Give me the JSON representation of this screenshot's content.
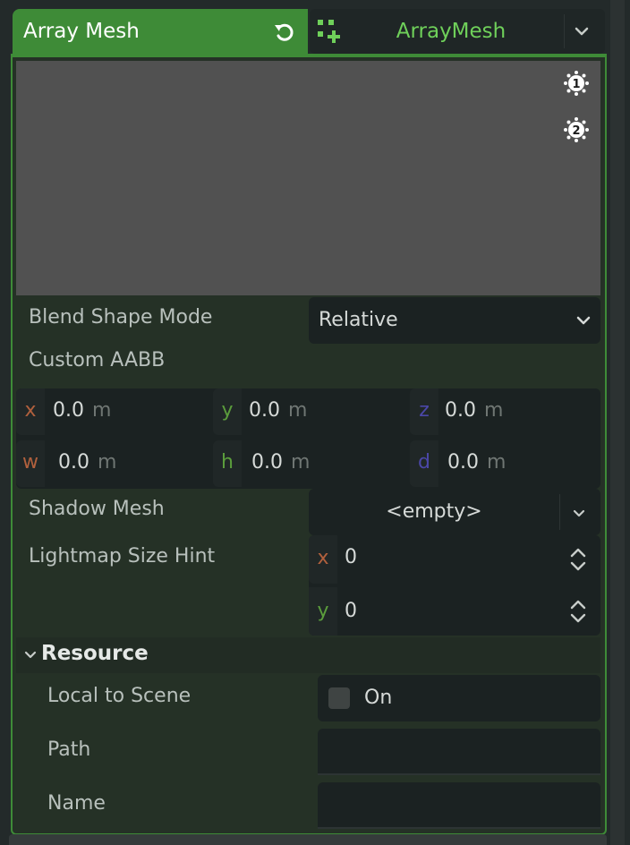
{
  "header": {
    "title": "Array Mesh",
    "resource_name": "ArrayMesh"
  },
  "preview": {
    "light1_label": "1",
    "light2_label": "2"
  },
  "properties": {
    "blend_shape_mode": {
      "label": "Blend Shape Mode",
      "value": "Relative"
    },
    "custom_aabb": {
      "label": "Custom AABB",
      "x": {
        "axis": "x",
        "value": "0.0",
        "unit": "m"
      },
      "y": {
        "axis": "y",
        "value": "0.0",
        "unit": "m"
      },
      "z": {
        "axis": "z",
        "value": "0.0",
        "unit": "m"
      },
      "w": {
        "axis": "w",
        "value": "0.0",
        "unit": "m"
      },
      "h": {
        "axis": "h",
        "value": "0.0",
        "unit": "m"
      },
      "d": {
        "axis": "d",
        "value": "0.0",
        "unit": "m"
      }
    },
    "shadow_mesh": {
      "label": "Shadow Mesh",
      "value": "<empty>"
    },
    "lightmap_size_hint": {
      "label": "Lightmap Size Hint",
      "x": {
        "axis": "x",
        "value": "0"
      },
      "y": {
        "axis": "y",
        "value": "0"
      }
    }
  },
  "resource_section": {
    "title": "Resource",
    "local_to_scene": {
      "label": "Local to Scene",
      "checkbox_label": "On",
      "checked": false
    },
    "path": {
      "label": "Path",
      "value": ""
    },
    "name": {
      "label": "Name",
      "value": ""
    }
  },
  "colors": {
    "accent_green": "#3e8b37",
    "resource_green": "#6fd05a",
    "axis_x": "#b1603d",
    "axis_y": "#5b9d3c",
    "axis_z": "#4b47a8"
  }
}
